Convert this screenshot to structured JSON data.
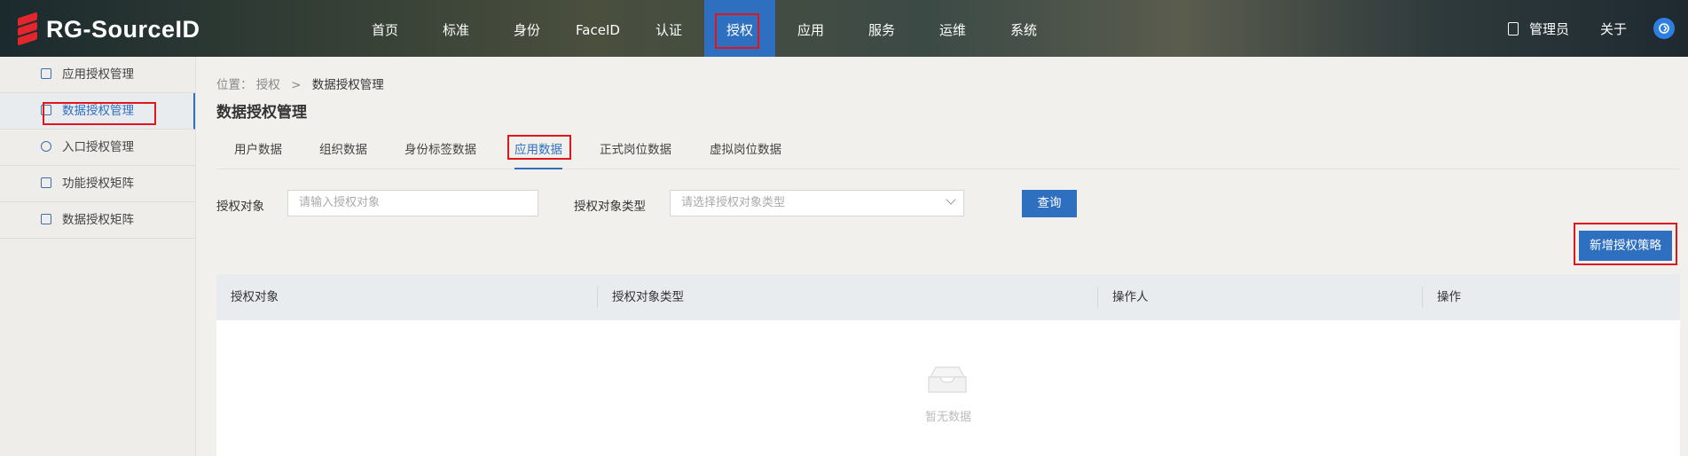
{
  "header": {
    "logo_text": "RG-SourceID",
    "nav": [
      {
        "label": "首页"
      },
      {
        "label": "标准"
      },
      {
        "label": "身份"
      },
      {
        "label": "FaceID"
      },
      {
        "label": "认证"
      },
      {
        "label": "授权",
        "active": true
      },
      {
        "label": "应用"
      },
      {
        "label": "服务"
      },
      {
        "label": "运维"
      },
      {
        "label": "系统"
      }
    ],
    "user_label": "管理员",
    "about_label": "关于"
  },
  "sidebar": {
    "items": [
      {
        "label": "应用授权管理",
        "icon": "app-auth-icon"
      },
      {
        "label": "数据授权管理",
        "icon": "data-auth-icon",
        "active": true
      },
      {
        "label": "入口授权管理",
        "icon": "entry-auth-icon"
      },
      {
        "label": "功能授权矩阵",
        "icon": "function-matrix-icon"
      },
      {
        "label": "数据授权矩阵",
        "icon": "data-matrix-icon"
      }
    ]
  },
  "breadcrumb": {
    "prefix": "位置：",
    "parent": "授权",
    "separator": ">",
    "current": "数据授权管理"
  },
  "page_title": "数据授权管理",
  "tabs": [
    {
      "label": "用户数据"
    },
    {
      "label": "组织数据"
    },
    {
      "label": "身份标签数据"
    },
    {
      "label": "应用数据",
      "active": true
    },
    {
      "label": "正式岗位数据"
    },
    {
      "label": "虚拟岗位数据"
    }
  ],
  "filters": {
    "object_label": "授权对象",
    "object_placeholder": "请输入授权对象",
    "type_label": "授权对象类型",
    "type_placeholder": "请选择授权对象类型",
    "query_button": "查询"
  },
  "add_button": "新增授权策略",
  "table": {
    "columns": [
      "授权对象",
      "授权对象类型",
      "操作人",
      "操作"
    ],
    "empty_text": "暂无数据"
  },
  "colors": {
    "accent": "#2f6fc0",
    "highlight_red": "#e0161c"
  }
}
